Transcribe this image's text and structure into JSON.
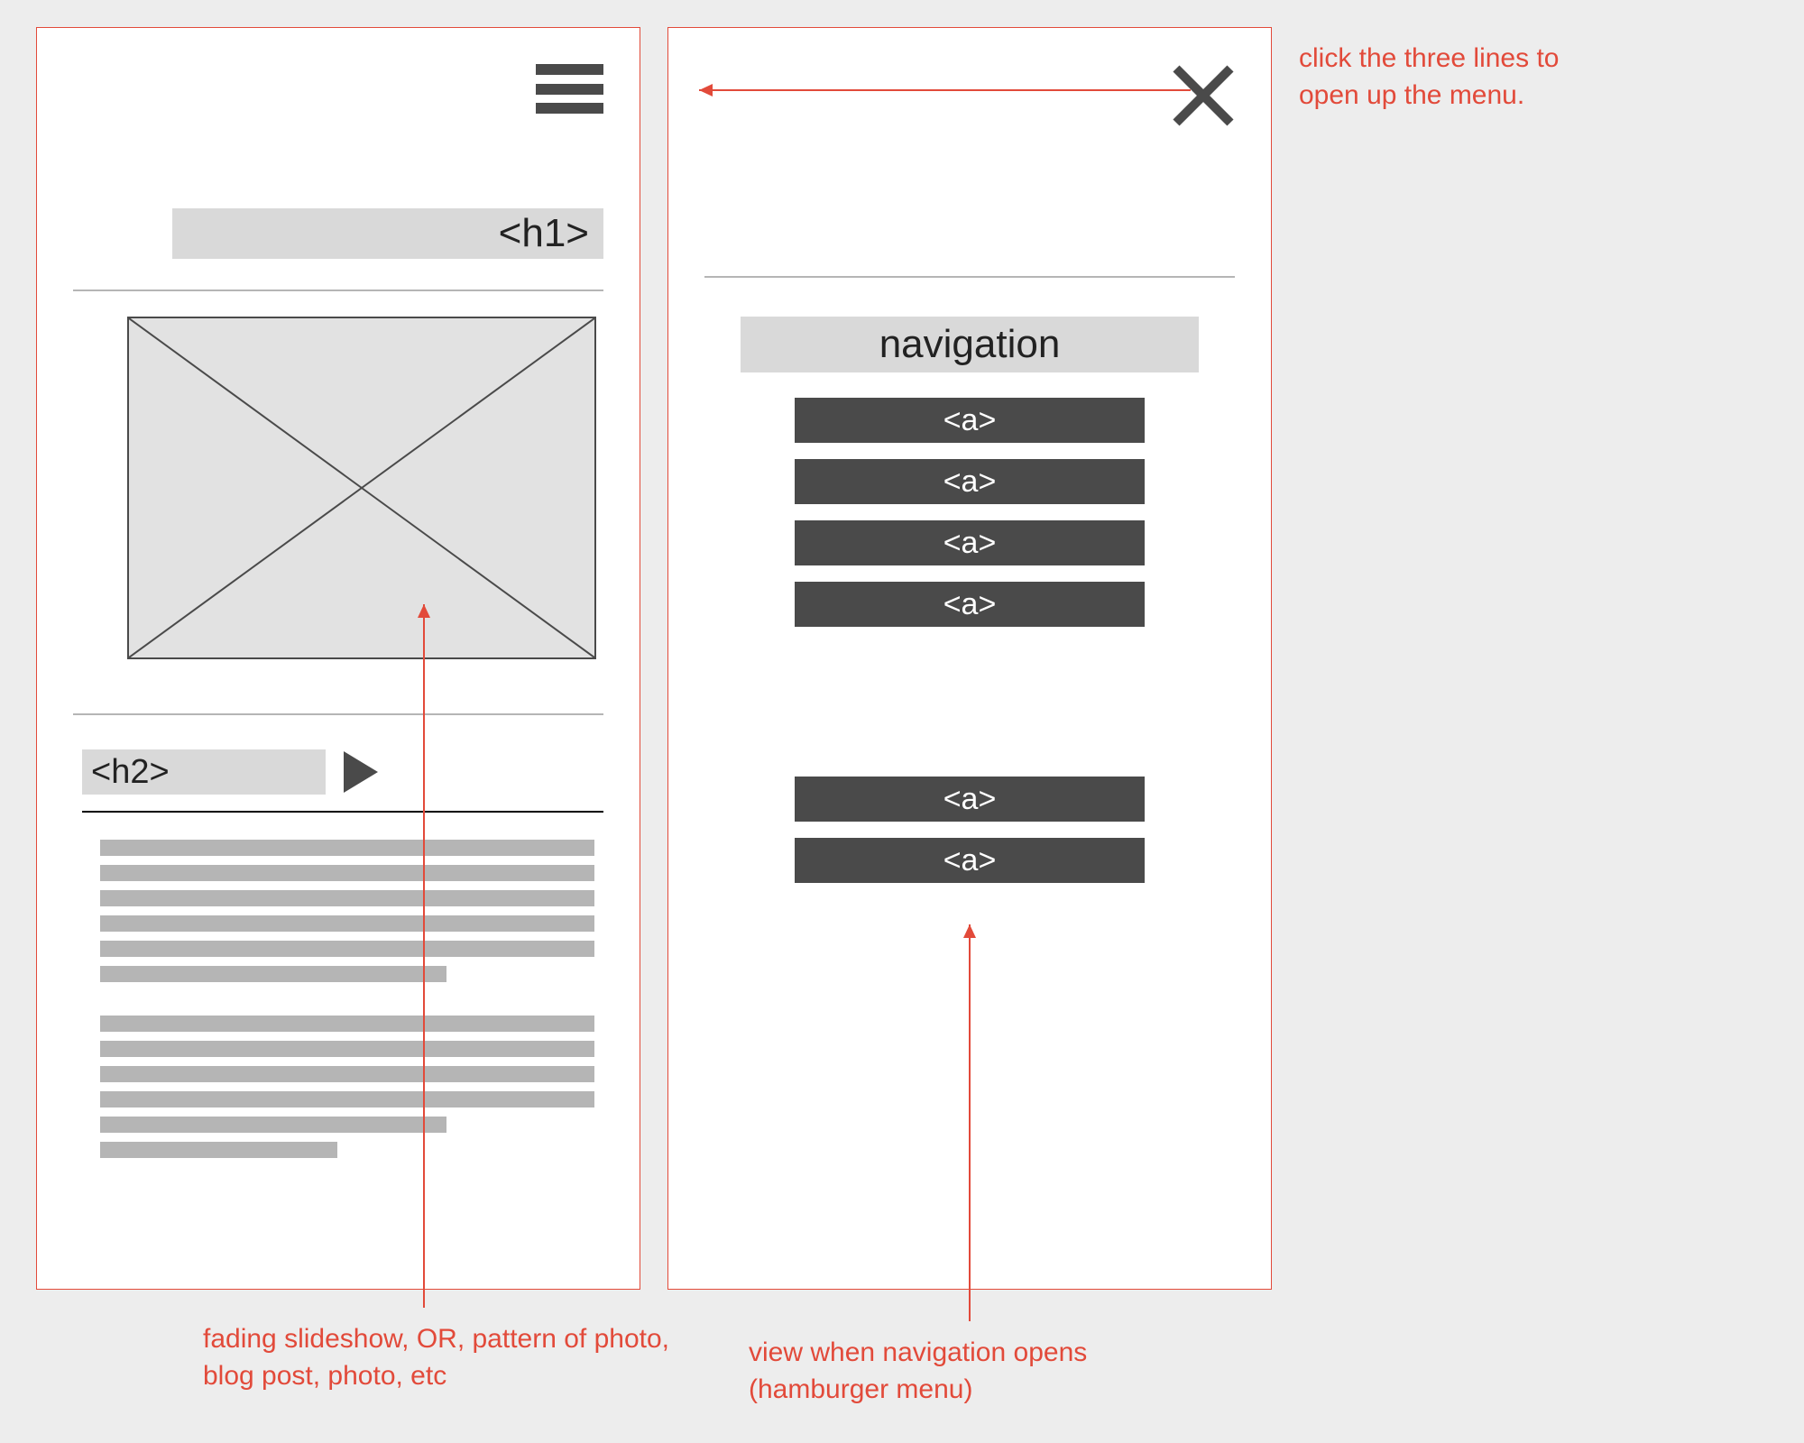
{
  "left": {
    "h1_label": "<h1>",
    "h2_label": "<h2>"
  },
  "right": {
    "nav_title": "navigation",
    "links_group1": [
      "<a>",
      "<a>",
      "<a>",
      "<a>"
    ],
    "links_group2": [
      "<a>",
      "<a>"
    ]
  },
  "annotations": {
    "top": "click the three lines to open up the menu.",
    "slideshow": "fading slideshow, OR, pattern of photo, blog post, photo, etc",
    "navopen": "view when navigation opens (hamburger menu)"
  }
}
